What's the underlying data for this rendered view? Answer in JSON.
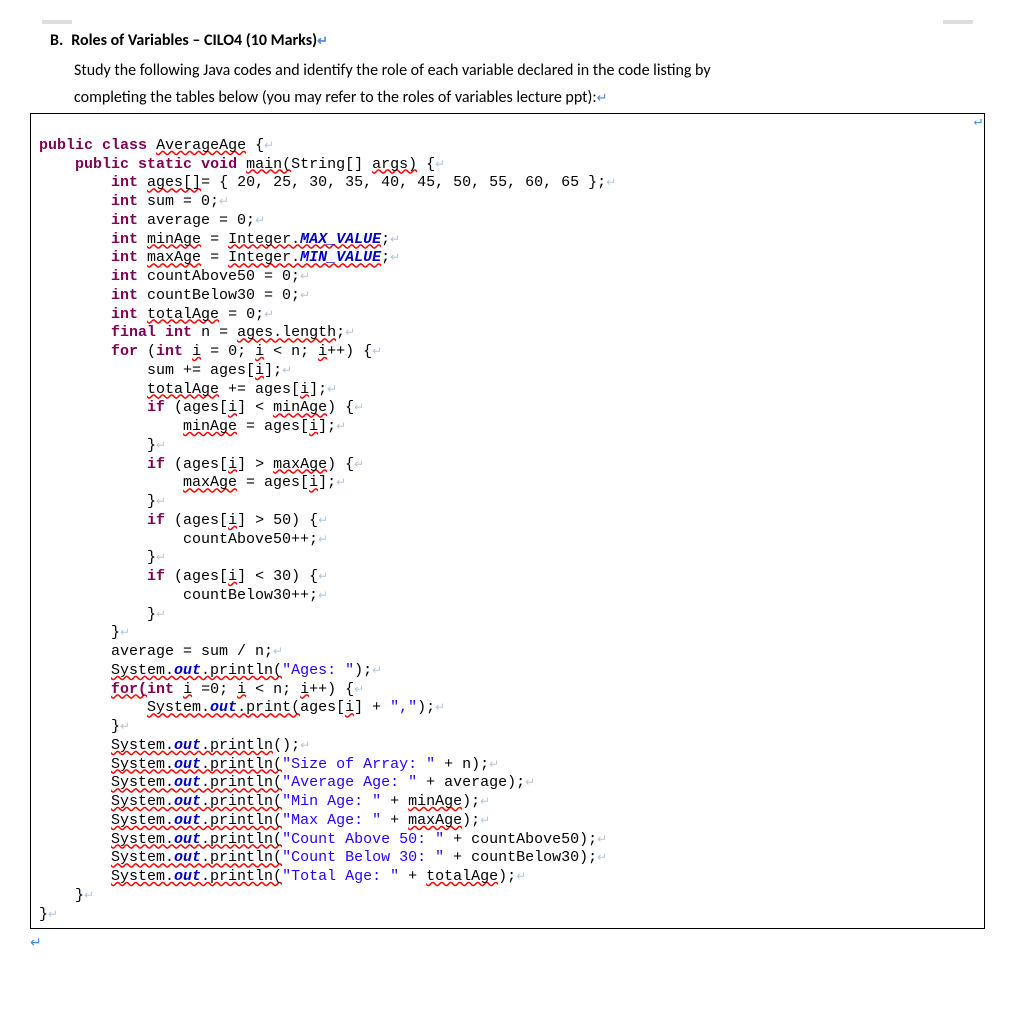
{
  "heading": {
    "letter": "B.",
    "title": "Roles of Variables – CILO4 (10 Marks)"
  },
  "intro_line1": "Study the following Java codes and identify the role of each variable declared in the code listing by",
  "intro_line2": "completing the tables below (you may refer to the roles of variables lecture ppt):",
  "code": {
    "class_decl": "public class AverageAge {",
    "main_sig": "public static void main(String[] args) {",
    "ages_decl": "int ages[]= { 20, 25, 30, 35, 40, 45, 50, 55, 60, 65 };",
    "sum_decl": "int sum = 0;",
    "avg_decl": "int average = 0;",
    "minage_decl": "int minAge = Integer.MAX_VALUE;",
    "maxage_decl": "int maxAge = Integer.MIN_VALUE;",
    "ca50_decl": "int countAbove50 = 0;",
    "cb30_decl": "int countBelow30 = 0;",
    "totalage_decl": "int totalAge = 0;",
    "n_decl": "final int n = ages.length;",
    "for1": "for (int i = 0; i < n; i++) {",
    "sum_add": "sum += ages[i];",
    "total_add": "totalAge += ages[i];",
    "if_min": "if (ages[i] < minAge) {",
    "min_assign": "minAge = ages[i];",
    "close_brace": "}",
    "if_max": "if (ages[i] > maxAge) {",
    "max_assign": "maxAge = ages[i];",
    "if_a50": "if (ages[i] > 50) {",
    "a50_inc": "countAbove50++;",
    "if_b30": "if (ages[i] < 30) {",
    "b30_inc": "countBelow30++;",
    "avg_calc": "average = sum / n;",
    "p_ages": "System.out.println(\"Ages: \");",
    "for2": "for(int i =0; i < n; i++) {",
    "print_item": "System.out.print(ages[i] + \",\");",
    "p_empty": "System.out.println();",
    "p_size": "System.out.println(\"Size of Array: \" + n);",
    "p_avg": "System.out.println(\"Average Age: \" + average);",
    "p_min": "System.out.println(\"Min Age: \" + minAge);",
    "p_max": "System.out.println(\"Max Age: \" + maxAge);",
    "p_ca50": "System.out.println(\"Count Above 50: \" + countAbove50);",
    "p_cb30": "System.out.println(\"Count Below 30: \" + countBelow30);",
    "p_total": "System.out.println(\"Total Age: \" + totalAge);"
  }
}
